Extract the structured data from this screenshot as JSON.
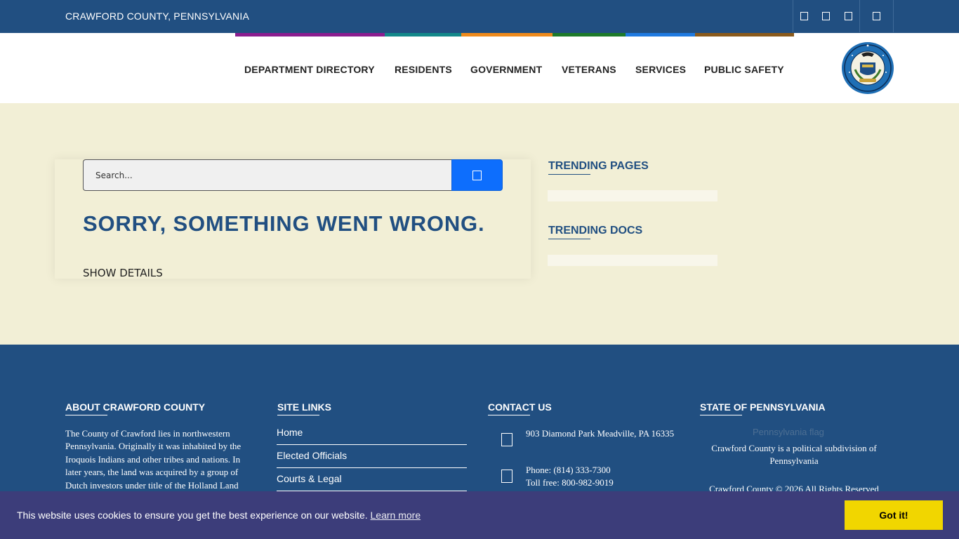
{
  "topbar": {
    "title": "CRAWFORD COUNTY, PENNSYLVANIA",
    "social_icons": [
      "facebook-icon",
      "twitter-icon",
      "youtube-icon",
      "phone-icon"
    ]
  },
  "color_strip": [
    "#8b1d8f",
    "#13888a",
    "#ee8a1c",
    "#1e7a2a",
    "#1f7ae0",
    "#8a5a1c"
  ],
  "nav": {
    "items": [
      "DEPARTMENT DIRECTORY",
      "RESIDENTS",
      "GOVERNMENT",
      "VETERANS",
      "SERVICES",
      "PUBLIC SAFETY"
    ]
  },
  "main": {
    "search_placeholder": "Search...",
    "error_title": "SORRY, SOMETHING WENT WRONG.",
    "show_details": "SHOW DETAILS"
  },
  "sidebar": {
    "trending_pages": "TRENDING PAGES",
    "trending_docs": "TRENDING DOCS"
  },
  "footer": {
    "about_head": "ABOUT CRAWFORD COUNTY",
    "about_text": "The County of Crawford lies in northwestern Pennsylvania. Originally it was inhabited by the Iroquois Indians and other tribes and nations. In later years, the land was acquired by a group of Dutch investors under title of the Holland Land",
    "links_head": "SITE LINKS",
    "links": [
      "Home",
      "Elected Officials",
      "Courts & Legal"
    ],
    "contact_head": "CONTACT US",
    "address": "903 Diamond Park Meadville, PA 16335",
    "phone": "Phone: (814) 333-7300",
    "toll_free": "Toll free: 800-982-9019",
    "state_head": "STATE OF PENNSYLVANIA",
    "flag_alt": "Pennsylvania flag",
    "state_text": "Crawford County is a political subdivision of Pennsylvania",
    "copyright": "Crawford County © 2026 All Rights Reserved"
  },
  "cookie": {
    "message": "This website uses cookies to ensure you get the best experience on our website.",
    "learn_more": "Learn more",
    "accept": "Got it!"
  }
}
